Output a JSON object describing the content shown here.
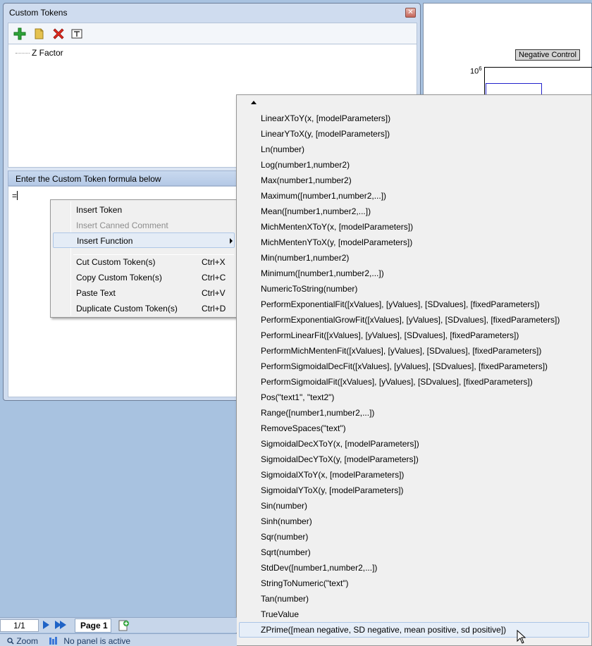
{
  "window": {
    "title": "Custom Tokens",
    "close_glyph": "✕"
  },
  "toolbar": {
    "icons": [
      "add-icon",
      "folder-icon",
      "delete-icon",
      "text-format-icon"
    ]
  },
  "tree": {
    "items": [
      "Z Factor"
    ]
  },
  "formula": {
    "header": "Enter the Custom Token formula below",
    "value": "="
  },
  "context_menu": {
    "items": [
      {
        "label": "Insert Token",
        "shortcut": "",
        "enabled": true
      },
      {
        "label": "Insert Canned Comment",
        "shortcut": "",
        "enabled": false
      },
      {
        "label": "Insert Function",
        "shortcut": "",
        "enabled": true,
        "submenu": true
      },
      {
        "label": "Cut Custom Token(s)",
        "shortcut": "Ctrl+X",
        "enabled": true
      },
      {
        "label": "Copy Custom Token(s)",
        "shortcut": "Ctrl+C",
        "enabled": true
      },
      {
        "label": "Paste Text",
        "shortcut": "Ctrl+V",
        "enabled": true
      },
      {
        "label": "Duplicate Custom Token(s)",
        "shortcut": "Ctrl+D",
        "enabled": true
      }
    ]
  },
  "function_menu": {
    "items": [
      "LinearXToY(x, [modelParameters])",
      "LinearYToX(y, [modelParameters])",
      "Ln(number)",
      "Log(number1,number2)",
      "Max(number1,number2)",
      "Maximum([number1,number2,...])",
      "Mean([number1,number2,...])",
      "MichMentenXToY(x, [modelParameters])",
      "MichMentenYToX(y, [modelParameters])",
      "Min(number1,number2)",
      "Minimum([number1,number2,...])",
      "NumericToString(number)",
      "PerformExponentialFit([xValues], [yValues], [SDvalues], [fixedParameters])",
      "PerformExponentialGrowFit([xValues], [yValues], [SDvalues], [fixedParameters])",
      "PerformLinearFit([xValues], [yValues], [SDvalues], [fixedParameters])",
      "PerformMichMentenFit([xValues], [yValues], [SDvalues], [fixedParameters])",
      "PerformSigmoidalDecFit([xValues], [yValues], [SDvalues], [fixedParameters])",
      "PerformSigmoidalFit([xValues], [yValues], [SDvalues], [fixedParameters])",
      "Pos(\"text1\", \"text2\")",
      "Range([number1,number2,...])",
      "RemoveSpaces(\"text\")",
      "SigmoidalDecXToY(x, [modelParameters])",
      "SigmoidalDecYToX(y, [modelParameters])",
      "SigmoidalXToY(x, [modelParameters])",
      "SigmoidalYToX(y, [modelParameters])",
      "Sin(number)",
      "Sinh(number)",
      "Sqr(number)",
      "Sqrt(number)",
      "StdDev([number1,number2,...])",
      "StringToNumeric(\"text\")",
      "Tan(number)",
      "TrueValue",
      "ZPrime([mean negative, SD negative, mean positive, sd positive])"
    ],
    "highlighted": "ZPrime([mean negative, SD negative, mean positive, sd positive])"
  },
  "chart": {
    "label": "Negative Control",
    "y_tick": "10",
    "y_tick_exp": "6"
  },
  "page_bar": {
    "page_number": "1/1",
    "page_tab": "Page 1"
  },
  "status_bar": {
    "zoom": "Zoom",
    "panel_status": "No panel is active"
  },
  "colors": {
    "accent": "#1f63c6",
    "menu_bg": "#f0f0f0",
    "highlight": "#e6eef8"
  }
}
